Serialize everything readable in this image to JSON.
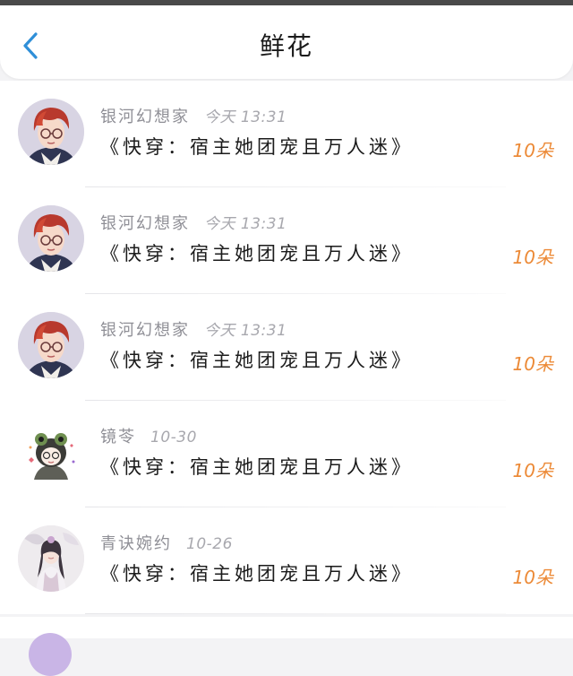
{
  "header": {
    "title": "鲜花",
    "back_icon": "chevron-left-icon",
    "accent": "#2f8fd8"
  },
  "rows": [
    {
      "name": "银河幻想家",
      "time": "今天 13:31",
      "book": "《快穿：宿主她团宠且万人迷》",
      "amount": "10朵",
      "avatar": "red-haired-glasses-boy"
    },
    {
      "name": "银河幻想家",
      "time": "今天 13:31",
      "book": "《快穿：宿主她团宠且万人迷》",
      "amount": "10朵",
      "avatar": "red-haired-glasses-boy"
    },
    {
      "name": "银河幻想家",
      "time": "今天 13:31",
      "book": "《快穿：宿主她团宠且万人迷》",
      "amount": "10朵",
      "avatar": "red-haired-glasses-boy"
    },
    {
      "name": "镜苓",
      "time": "10-30",
      "book": "《快穿：宿主她团宠且万人迷》",
      "amount": "10朵",
      "avatar": "frog-hat-chibi"
    },
    {
      "name": "青诀婉约",
      "time": "10-26",
      "book": "《快穿：宿主她团宠且万人迷》",
      "amount": "10朵",
      "avatar": "ancient-costume-girl"
    }
  ],
  "colors": {
    "amount": "#ec8a37",
    "meta": "#8f8f96",
    "book": "#1b1b1b"
  }
}
